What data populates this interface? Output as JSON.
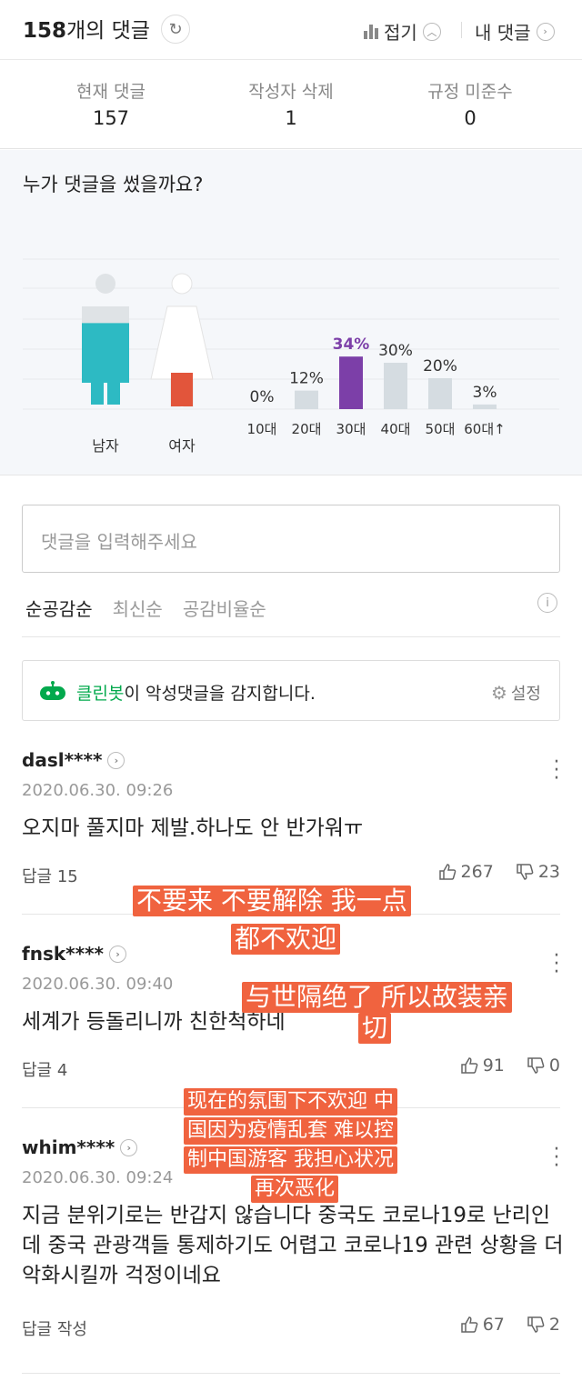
{
  "header": {
    "count": "158",
    "count_suffix": "개의 댓글",
    "fold_label": "접기",
    "my_comments_label": "내 댓글"
  },
  "stats": [
    {
      "label": "현재 댓글",
      "value": "157"
    },
    {
      "label": "작성자 삭제",
      "value": "1"
    },
    {
      "label": "규정 미준수",
      "value": "0"
    }
  ],
  "demographics": {
    "title": "누가 댓글을 썼을까요?",
    "gender": {
      "male_label": "남자",
      "female_label": "여자",
      "male_share": 0.83,
      "female_share": 0.17
    },
    "colors": {
      "male": "#2dbac3",
      "female_bottom": "#e2553b",
      "highlight": "#7c3fa8",
      "bar": "#d5dce1"
    }
  },
  "chart_data": {
    "type": "bar",
    "categories": [
      "10대",
      "20대",
      "30대",
      "40대",
      "50대",
      "60대↑"
    ],
    "values": [
      0,
      12,
      34,
      30,
      20,
      3
    ],
    "value_labels": [
      "0%",
      "12%",
      "34%",
      "30%",
      "20%",
      "3%"
    ],
    "highlight_index": 2,
    "ylim": [
      0,
      100
    ]
  },
  "input": {
    "placeholder": "댓글을 입력해주세요"
  },
  "sort": {
    "options": [
      "순공감순",
      "최신순",
      "공감비율순"
    ],
    "active": 0
  },
  "cleanbot": {
    "brand": "클린봇",
    "text": "이 악성댓글을 감지합니다.",
    "setting_label": "설정"
  },
  "comments": [
    {
      "user": "dasl****",
      "date": "2020.06.30. 09:26",
      "text": "오지마 풀지마 제발.하나도 안 반가워ㅠ",
      "reply": "답글 15",
      "likes": "267",
      "dislikes": "23"
    },
    {
      "user": "fnsk****",
      "date": "2020.06.30. 09:40",
      "text": "세계가 등돌리니까 친한척하네",
      "reply": "답글 4",
      "likes": "91",
      "dislikes": "0"
    },
    {
      "user": "whim****",
      "date": "2020.06.30. 09:24",
      "text": "지금 분위기로는 반갑지 않습니다 중국도 코로나19로 난리인데 중국 관광객들 통제하기도 어렵고 코로나19 관련 상황을 더 악화시킬까 걱정이네요",
      "reply": "답글 작성",
      "likes": "67",
      "dislikes": "2"
    }
  ],
  "subtitles": [
    "不要来 不要解除 我一点",
    "都不欢迎",
    "与世隔绝了 所以故装亲",
    "切",
    "现在的氛围下不欢迎 中",
    "国因为疫情乱套 难以控",
    "制中国游客 我担心状况",
    "再次恶化"
  ]
}
